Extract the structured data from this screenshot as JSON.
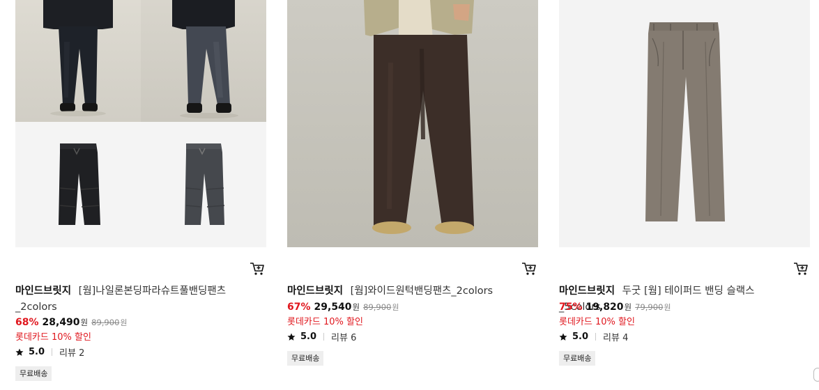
{
  "products": [
    {
      "brand": "마인드브릿지",
      "name": "[웜]나일론본딩파라슈트풀밴딩팬츠_2colors",
      "discount": "68%",
      "sale_price": "28,490",
      "currency": "원",
      "original_price": "89,900",
      "promo": "롯데카드 10% 할인",
      "rating": "5.0",
      "reviews_label": "리뷰 2",
      "badge": "무료배송",
      "image_colors": [
        "#1c1f26",
        "#3a3d42"
      ]
    },
    {
      "brand": "마인드브릿지",
      "name": "[웜]와이드원턱밴딩팬츠_2colors",
      "discount": "67%",
      "sale_price": "29,540",
      "currency": "원",
      "original_price": "89,900",
      "promo": "롯데카드 10% 할인",
      "rating": "5.0",
      "reviews_label": "리뷰 6",
      "badge": "무료배송",
      "image_colors": [
        "#3b2c26"
      ]
    },
    {
      "brand": "마인드브릿지",
      "name": "두굿 [웜] 테이퍼드 밴딩 슬랙스_5colors",
      "discount": "75%",
      "sale_price": "19,820",
      "currency": "원",
      "original_price": "79,900",
      "promo": "롯데카드 10% 할인",
      "rating": "5.0",
      "reviews_label": "리뷰 4",
      "badge": "무료배송",
      "image_colors": [
        "#827a70"
      ]
    }
  ],
  "icons": {
    "cart": "cart-icon",
    "star": "star-icon"
  },
  "colors": {
    "discount": "#e0171e",
    "badge_bg": "#eeeeee"
  }
}
